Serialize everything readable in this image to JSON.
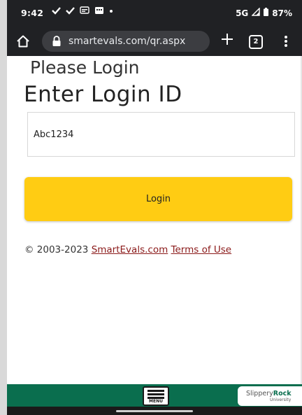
{
  "status_bar": {
    "time": "9:42",
    "network": "5G",
    "battery": "87%"
  },
  "browser": {
    "url": "smartevals.com/qr.aspx",
    "tab_count": "2"
  },
  "page": {
    "subtitle": "Please Login",
    "title": "Enter Login ID",
    "login_id_value": "Abc1234",
    "login_button_label": "Login",
    "footer": {
      "copyright": "© 2003-2023",
      "site_link": "SmartEvals.com",
      "terms_link": "Terms of Use"
    }
  },
  "bottom_bar": {
    "menu_label": "MENU",
    "logo_name_part1": "Slippery",
    "logo_name_part2": "Rock",
    "logo_sub": "University"
  },
  "colors": {
    "status_bg": "#202124",
    "button_yellow": "#ffcc13",
    "link_red": "#8b1a1a",
    "footer_green": "#0a6e4e"
  }
}
